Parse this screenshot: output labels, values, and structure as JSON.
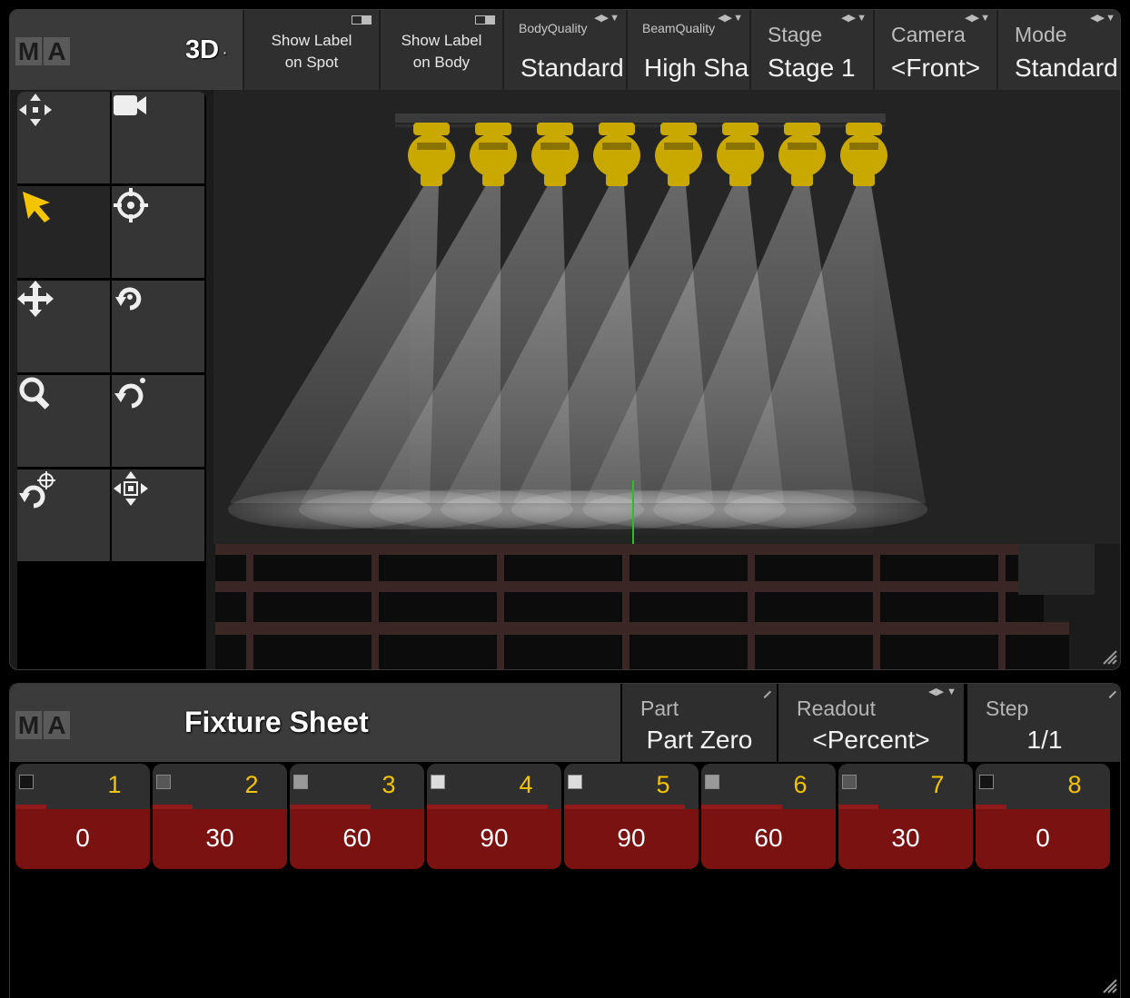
{
  "window3d": {
    "logo": [
      "M",
      "A"
    ],
    "title": "3D",
    "title_suffix": "·",
    "toggles": [
      {
        "label_line1": "Show Label",
        "label_line2": "on Spot"
      },
      {
        "label_line1": "Show Label",
        "label_line2": "on Body"
      }
    ],
    "selectors": [
      {
        "label": "BodyQuality",
        "value": "Standard"
      },
      {
        "label": "BeamQuality",
        "value": "High Shadow"
      },
      {
        "label": "Stage",
        "value": "Stage 1"
      },
      {
        "label": "Camera",
        "value": "<Front>"
      },
      {
        "label": "Mode",
        "value": "Standard"
      }
    ],
    "tools": [
      {
        "name": "move-view-icon"
      },
      {
        "name": "camera-icon"
      },
      {
        "name": "select-arrow-icon",
        "active": true
      },
      {
        "name": "target-icon"
      },
      {
        "name": "move-icon"
      },
      {
        "name": "rotate-icon"
      },
      {
        "name": "zoom-icon"
      },
      {
        "name": "orbit-icon"
      },
      {
        "name": "rotate-around-icon"
      },
      {
        "name": "fit-view-icon"
      }
    ],
    "colors": {
      "fixture": "#c9a800",
      "beam": "#ffffff",
      "accent_yellow": "#f5c400"
    }
  },
  "fixture_sheet": {
    "logo": [
      "M",
      "A"
    ],
    "title": "Fixture Sheet",
    "part": {
      "label": "Part",
      "value": "Part Zero"
    },
    "readout": {
      "label": "Readout",
      "value": "<Percent>"
    },
    "step": {
      "label": "Step",
      "value": "1/1"
    },
    "channels": [
      {
        "id": "1",
        "value": "0"
      },
      {
        "id": "2",
        "value": "30"
      },
      {
        "id": "3",
        "value": "60"
      },
      {
        "id": "4",
        "value": "90"
      },
      {
        "id": "5",
        "value": "90"
      },
      {
        "id": "6",
        "value": "60"
      },
      {
        "id": "7",
        "value": "30"
      },
      {
        "id": "8",
        "value": "0"
      }
    ],
    "colors": {
      "value_bg": "#7a1212",
      "id_text": "#f5c400"
    }
  }
}
